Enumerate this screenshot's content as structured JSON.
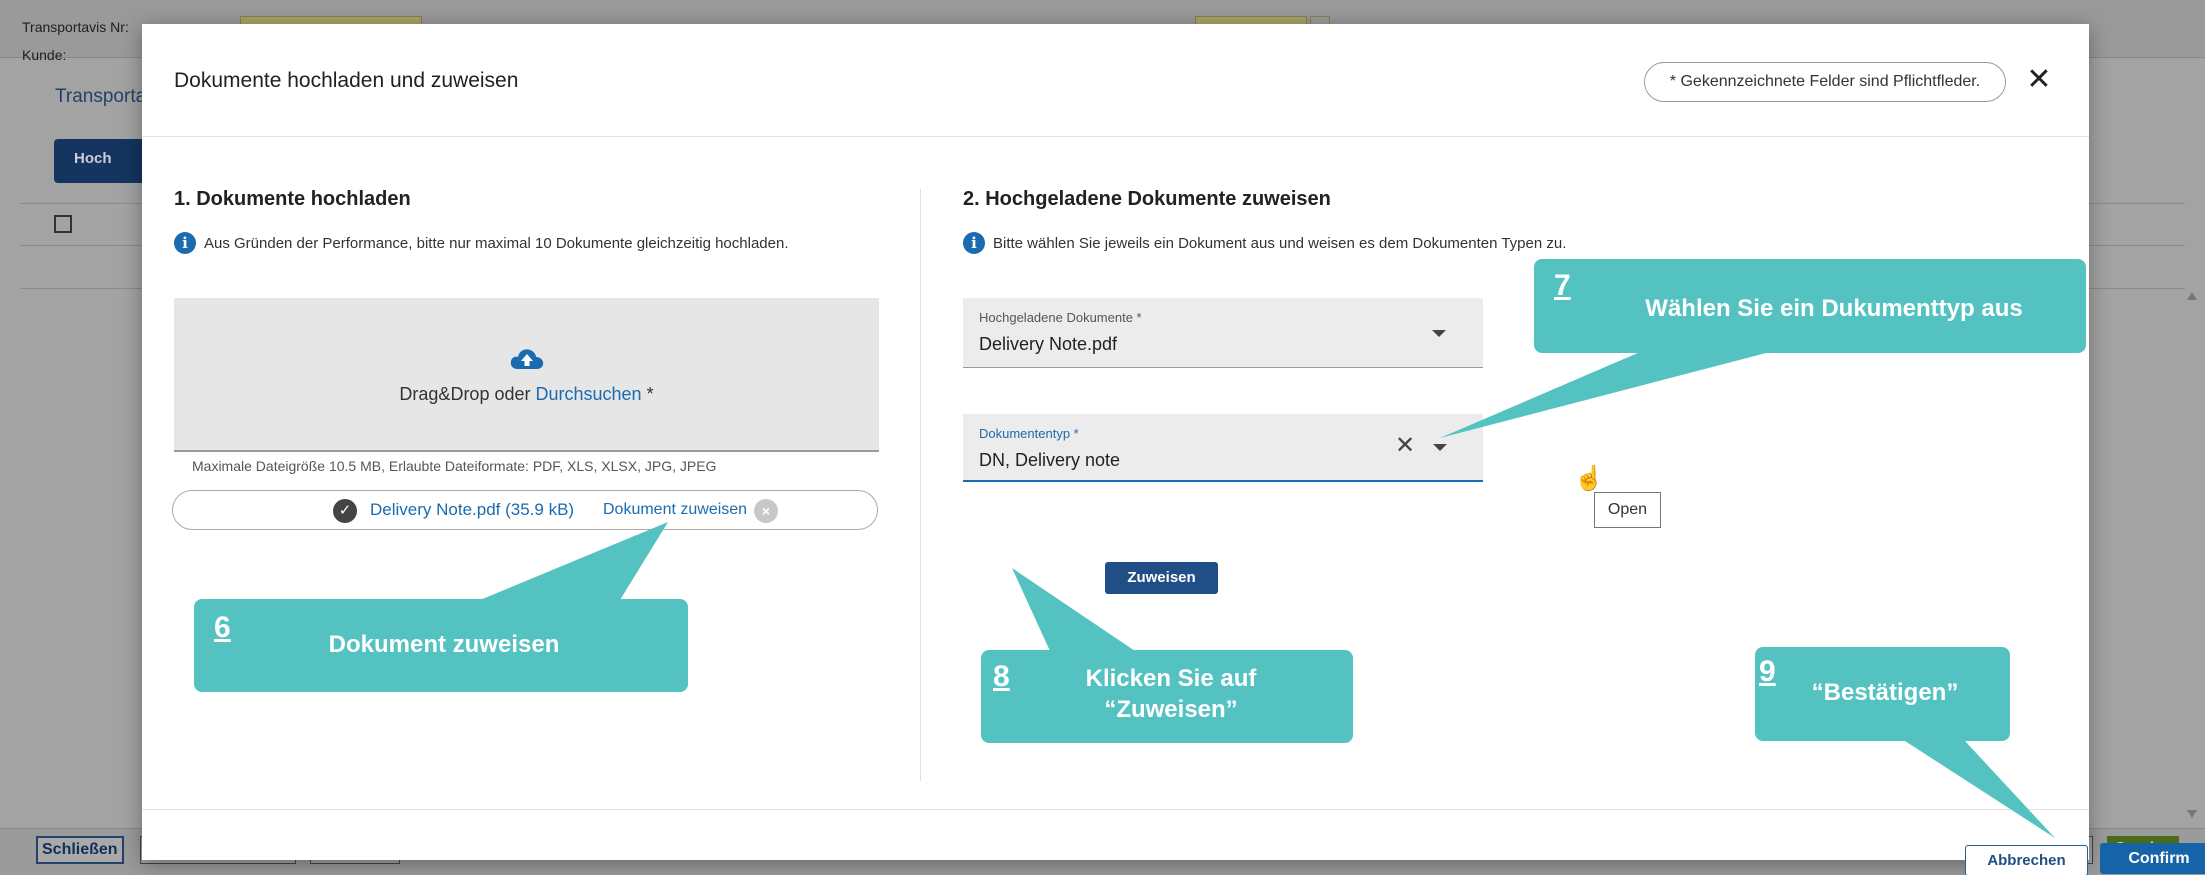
{
  "background": {
    "transport_label": "Transportavis Nr:",
    "customer_label": "Kunde:",
    "tab_label": "Transporta",
    "upload_button": "Hoch",
    "close_button": "Schließen",
    "send_button": "Senden"
  },
  "dialog": {
    "title": "Dokumente hochladen und zuweisen",
    "required_note": "* Gekennzeichnete Felder sind Pflichtfleder.",
    "close_icon": "close-icon"
  },
  "upload_section": {
    "title": "1. Dokumente hochladen",
    "info": "Aus Gründen der Performance, bitte nur maximal 10 Dokumente gleichzeitig hochladen.",
    "drop_text": "Drag&Drop oder ",
    "drop_link": "Durchsuchen",
    "drop_required": " *",
    "max_size": "Maximale Dateigröße 10.5 MB, Erlaubte Dateiformate: PDF, XLS, XLSX, JPG, JPEG",
    "file_name": "Delivery Note.pdf (35.9 kB)",
    "assign_link": "Dokument zuweisen"
  },
  "assign_section": {
    "title": "2. Hochgeladene Dokumente zuweisen",
    "info": "Bitte wählen Sie jeweils ein Dokument aus und weisen es dem Dokumenten Typen zu.",
    "uploaded_docs_label": "Hochgeladene Dokumente *",
    "uploaded_docs_value": "Delivery Note.pdf",
    "doc_type_label": "Dokumententyp *",
    "doc_type_value": "DN, Delivery note",
    "tooltip": "Open",
    "assign_button": "Zuweisen"
  },
  "footer": {
    "cancel_button": "Abbrechen",
    "confirm_button": "Confirm"
  },
  "callouts": [
    {
      "num": "6",
      "text": "Dokument zuweisen"
    },
    {
      "num": "7",
      "text": "Wählen Sie ein Dukumenttyp aus"
    },
    {
      "num": "8",
      "text": "Klicken Sie auf “Zuweisen”"
    },
    {
      "num": "9",
      "text": "“Bestätigen”"
    }
  ],
  "colors": {
    "accent": "#1a6bb0",
    "primary_button": "#1663a8",
    "callout": "#55c2c2",
    "send_button": "#4c6b19"
  }
}
